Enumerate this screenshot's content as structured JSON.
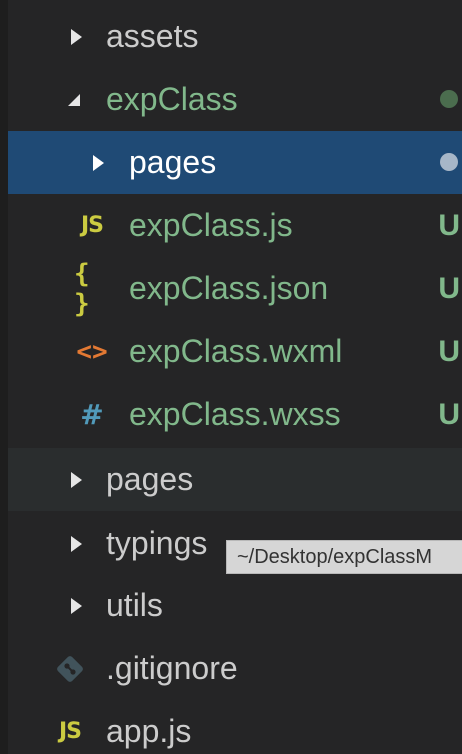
{
  "explorer": {
    "items": [
      {
        "label": "assets",
        "icon": "chevron-right-icon"
      },
      {
        "label": "expClass",
        "icon": "chevron-down-icon",
        "status_color": "#4b6d4e"
      },
      {
        "label": "pages",
        "icon": "chevron-right-icon",
        "status_color": "#a7b7c8"
      },
      {
        "label": "expClass.js",
        "icon": "js-file-icon",
        "icon_text": "JS",
        "badge": "U"
      },
      {
        "label": "expClass.json",
        "icon": "json-file-icon",
        "icon_text": "{ }",
        "badge": "U"
      },
      {
        "label": "expClass.wxml",
        "icon": "xml-file-icon",
        "icon_text": "<>",
        "badge": "U"
      },
      {
        "label": "expClass.wxss",
        "icon": "css-file-icon",
        "icon_text": "#",
        "badge": "U"
      },
      {
        "label": "pages",
        "icon": "chevron-right-icon"
      },
      {
        "label": "typings",
        "icon": "chevron-right-icon"
      },
      {
        "label": "utils",
        "icon": "chevron-right-icon"
      },
      {
        "label": ".gitignore",
        "icon": "git-icon"
      },
      {
        "label": "app.js",
        "icon": "js-file-icon",
        "icon_text": "JS"
      }
    ]
  },
  "tooltip": {
    "text": "~/Desktop/expClassM"
  },
  "colors": {
    "background": "#252526",
    "selected_row": "#1f4a75",
    "untracked_green": "#81b88b",
    "folder_text": "#cccccc"
  }
}
